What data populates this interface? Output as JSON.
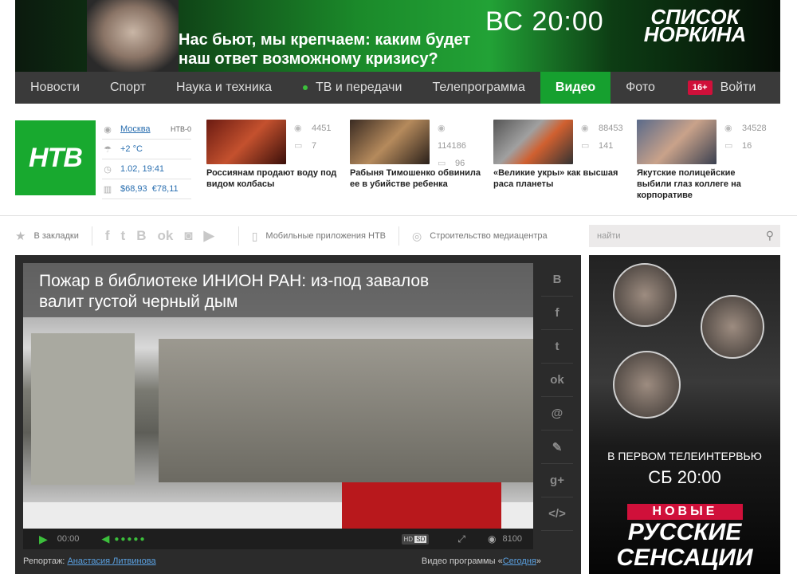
{
  "banner": {
    "headline_line1": "Нас бьют, мы крепчаем: каким будет",
    "headline_line2": "наш ответ возможному кризису?",
    "time": "ВС 20:00",
    "show_logo_line1": "СПИСОК",
    "show_logo_line2": "НОРКИНА"
  },
  "nav": {
    "items": [
      "Новости",
      "Спорт",
      "Наука и техника",
      "ТВ и передачи",
      "Телепрограмма",
      "Видео",
      "Фото"
    ],
    "age_badge": "16+",
    "login": "Войти"
  },
  "logo": {
    "text": "НТВ"
  },
  "info": {
    "city": "Москва",
    "channel": "НТВ-0",
    "temperature": "+2 °C",
    "datetime": "1.02, 19:41",
    "usd": "$68,93",
    "eur": "€78,11"
  },
  "news": [
    {
      "views": "4451",
      "comments": "7",
      "caption": "Россиянам продают воду под видом колбасы"
    },
    {
      "views": "114186",
      "comments": "96",
      "caption": "Рабыня Тимошенко обвинила ее в убийстве ребенка"
    },
    {
      "views": "88453",
      "comments": "141",
      "caption": "«Великие укры» как высшая раса планеты"
    },
    {
      "views": "34528",
      "comments": "16",
      "caption": "Якутские полицейские выбили глаз коллеге на корпоративе"
    }
  ],
  "toolbar": {
    "bookmarks": "В закладки",
    "apps": "Мобильные приложения НТВ",
    "build": "Строительство медиацентра",
    "search_placeholder": "найти"
  },
  "video": {
    "title_line1": "Пожар в библиотеке ИНИОН РАН: из-под завалов",
    "title_line2": "валит густой черный дым",
    "time": "00:00",
    "hd": "HD",
    "sd": "SD",
    "views": "8100",
    "reporter_label": "Репортаж:",
    "reporter": "Анастасия Литвинова",
    "program_label": "Видео программы «",
    "program": "Сегодня",
    "program_end": "»"
  },
  "ad": {
    "line1": "В ПЕРВОМ ТЕЛЕИНТЕРВЬЮ",
    "line2": "СБ 20:00",
    "line3": "НОВЫЕ",
    "line4": "РУССКИЕ",
    "line5": "СЕНСАЦИИ"
  },
  "colors": {
    "brand_green": "#16a02f",
    "nav_bg": "#3a3a3a",
    "badge_red": "#d0103a",
    "link_blue": "#2a6fb0"
  }
}
